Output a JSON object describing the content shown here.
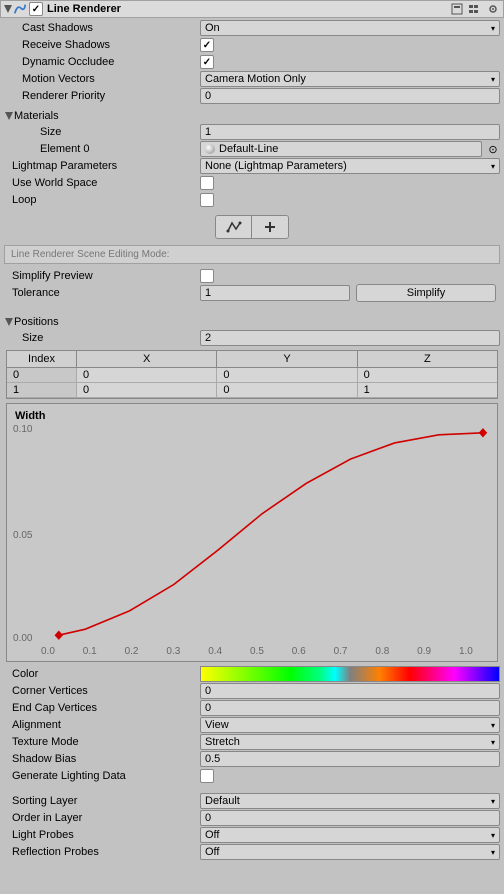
{
  "header": {
    "title": "Line Renderer",
    "enabled": true
  },
  "props": {
    "castShadows": {
      "label": "Cast Shadows",
      "value": "On"
    },
    "receiveShadows": {
      "label": "Receive Shadows",
      "checked": true
    },
    "dynamicOccludee": {
      "label": "Dynamic Occludee",
      "checked": true
    },
    "motionVectors": {
      "label": "Motion Vectors",
      "value": "Camera Motion Only"
    },
    "rendererPriority": {
      "label": "Renderer Priority",
      "value": "0"
    },
    "materials": {
      "label": "Materials"
    },
    "materialsSize": {
      "label": "Size",
      "value": "1"
    },
    "element0": {
      "label": "Element 0",
      "value": "Default-Line"
    },
    "lightmapParams": {
      "label": "Lightmap Parameters",
      "value": "None (Lightmap Parameters)"
    },
    "useWorldSpace": {
      "label": "Use World Space",
      "checked": false
    },
    "loop": {
      "label": "Loop",
      "checked": false
    },
    "sceneEditMode": "Line Renderer Scene Editing Mode:",
    "simplifyPreview": {
      "label": "Simplify Preview",
      "checked": false
    },
    "tolerance": {
      "label": "Tolerance",
      "value": "1"
    },
    "simplifyBtn": "Simplify",
    "positions": {
      "label": "Positions"
    },
    "positionsSize": {
      "label": "Size",
      "value": "2"
    },
    "tableHeaders": {
      "index": "Index",
      "x": "X",
      "y": "Y",
      "z": "Z"
    },
    "tableRows": [
      {
        "index": "0",
        "x": "0",
        "y": "0",
        "z": "0"
      },
      {
        "index": "1",
        "x": "0",
        "y": "0",
        "z": "1"
      }
    ],
    "widthLabel": "Width",
    "color": {
      "label": "Color"
    },
    "cornerVertices": {
      "label": "Corner Vertices",
      "value": "0"
    },
    "endCapVertices": {
      "label": "End Cap Vertices",
      "value": "0"
    },
    "alignment": {
      "label": "Alignment",
      "value": "View"
    },
    "textureMode": {
      "label": "Texture Mode",
      "value": "Stretch"
    },
    "shadowBias": {
      "label": "Shadow Bias",
      "value": "0.5"
    },
    "generateLighting": {
      "label": "Generate Lighting Data",
      "checked": false
    },
    "sortingLayer": {
      "label": "Sorting Layer",
      "value": "Default"
    },
    "orderInLayer": {
      "label": "Order in Layer",
      "value": "0"
    },
    "lightProbes": {
      "label": "Light Probes",
      "value": "Off"
    },
    "reflectionProbes": {
      "label": "Reflection Probes",
      "value": "Off"
    }
  },
  "chart_data": {
    "type": "line",
    "title": "Width",
    "xlabel": "",
    "ylabel": "",
    "xlim": [
      0.0,
      1.0
    ],
    "ylim": [
      0.0,
      0.1
    ],
    "x_ticks": [
      "0.0",
      "0.1",
      "0.2",
      "0.3",
      "0.4",
      "0.5",
      "0.6",
      "0.7",
      "0.8",
      "0.9",
      "1.0"
    ],
    "y_ticks": [
      "0.00",
      "0.05",
      "0.10"
    ],
    "series": [
      {
        "name": "width",
        "color": "#d00000",
        "x": [
          0.04,
          0.1,
          0.2,
          0.3,
          0.4,
          0.5,
          0.6,
          0.7,
          0.8,
          0.9,
          1.0
        ],
        "y": [
          0.0,
          0.003,
          0.012,
          0.025,
          0.042,
          0.06,
          0.075,
          0.087,
          0.095,
          0.099,
          0.1
        ]
      }
    ],
    "keypoints": [
      {
        "x": 0.04,
        "y": 0.0
      },
      {
        "x": 1.0,
        "y": 0.1
      }
    ]
  }
}
